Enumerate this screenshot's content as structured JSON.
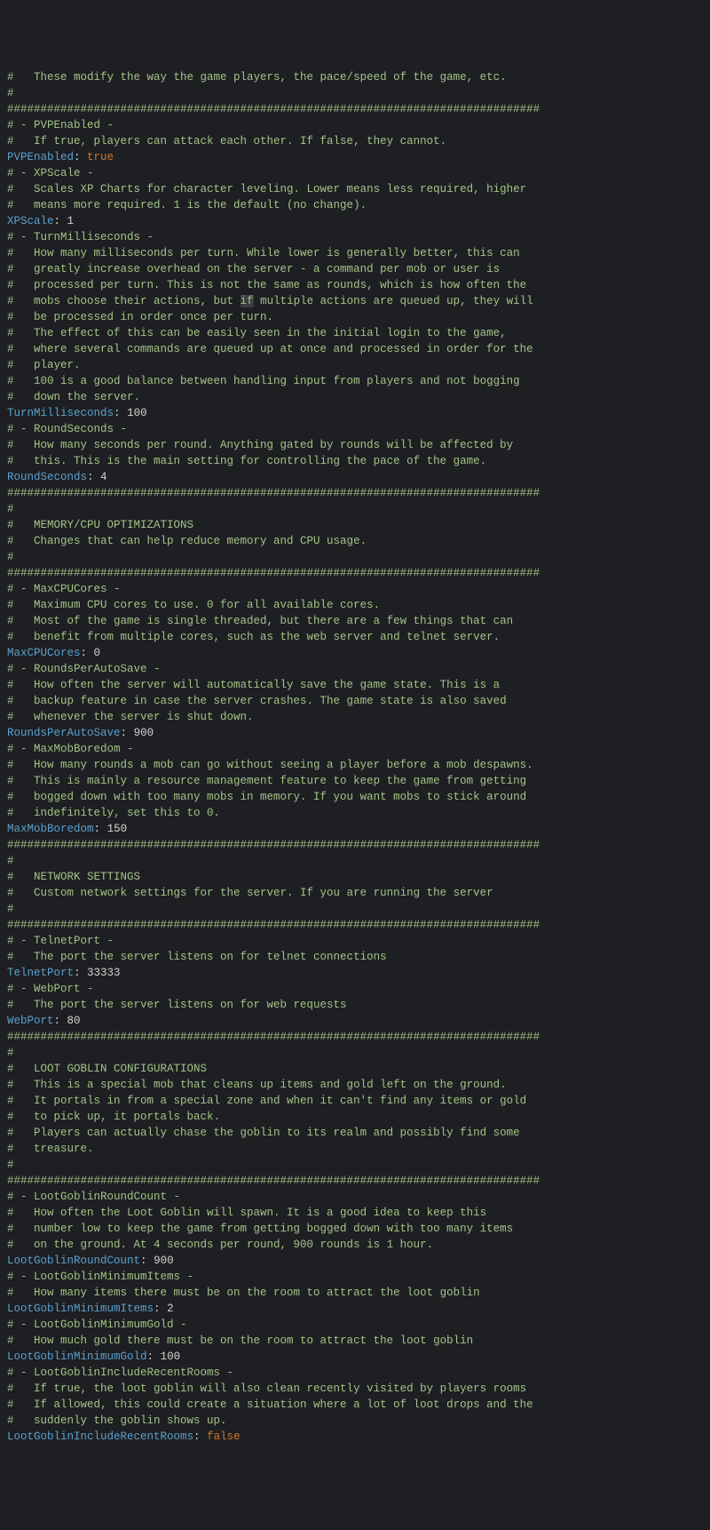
{
  "lines": [
    {
      "t": "c",
      "v": "#   These modify the way the game players, the pace/speed of the game, etc."
    },
    {
      "t": "c",
      "v": "#"
    },
    {
      "t": "c",
      "v": "################################################################################"
    },
    {
      "t": "c",
      "v": "# - PVPEnabled -"
    },
    {
      "t": "c",
      "v": "#   If true, players can attack each other. If false, they cannot."
    },
    {
      "t": "kv",
      "k": "PVPEnabled",
      "v": "true",
      "vt": "b"
    },
    {
      "t": "c",
      "v": "# - XPScale -"
    },
    {
      "t": "c",
      "v": "#   Scales XP Charts for character leveling. Lower means less required, higher"
    },
    {
      "t": "c",
      "v": "#   means more required. 1 is the default (no change)."
    },
    {
      "t": "kv",
      "k": "XPScale",
      "v": "1",
      "vt": "n"
    },
    {
      "t": "c",
      "v": "# - TurnMilliseconds -"
    },
    {
      "t": "c",
      "v": "#   How many milliseconds per turn. While lower is generally better, this can"
    },
    {
      "t": "c",
      "v": "#   greatly increase overhead on the server - a command per mob or user is"
    },
    {
      "t": "c",
      "v": "#   processed per turn. This is not the same as rounds, which is how often the"
    },
    {
      "t": "c-hl",
      "pre": "#   mobs choose their actions, but ",
      "hl": "if",
      "post": " multiple actions are queued up, they will"
    },
    {
      "t": "c",
      "v": "#   be processed in order once per turn."
    },
    {
      "t": "c",
      "v": "#   The effect of this can be easily seen in the initial login to the game,"
    },
    {
      "t": "c",
      "v": "#   where several commands are queued up at once and processed in order for the"
    },
    {
      "t": "c",
      "v": "#   player."
    },
    {
      "t": "c",
      "v": "#   100 is a good balance between handling input from players and not bogging"
    },
    {
      "t": "c",
      "v": "#   down the server."
    },
    {
      "t": "kv",
      "k": "TurnMilliseconds",
      "v": "100",
      "vt": "n"
    },
    {
      "t": "c",
      "v": "# - RoundSeconds -"
    },
    {
      "t": "c",
      "v": "#   How many seconds per round. Anything gated by rounds will be affected by"
    },
    {
      "t": "c",
      "v": "#   this. This is the main setting for controlling the pace of the game."
    },
    {
      "t": "kv",
      "k": "RoundSeconds",
      "v": "4",
      "vt": "n"
    },
    {
      "t": "c",
      "v": "################################################################################"
    },
    {
      "t": "c",
      "v": "#"
    },
    {
      "t": "c",
      "v": "#   MEMORY/CPU OPTIMIZATIONS"
    },
    {
      "t": "c",
      "v": "#   Changes that can help reduce memory and CPU usage."
    },
    {
      "t": "c",
      "v": "#"
    },
    {
      "t": "c",
      "v": "################################################################################"
    },
    {
      "t": "c",
      "v": "# - MaxCPUCores -"
    },
    {
      "t": "c",
      "v": "#   Maximum CPU cores to use. 0 for all available cores."
    },
    {
      "t": "c",
      "v": "#   Most of the game is single threaded, but there are a few things that can"
    },
    {
      "t": "c",
      "v": "#   benefit from multiple cores, such as the web server and telnet server."
    },
    {
      "t": "kv",
      "k": "MaxCPUCores",
      "v": "0",
      "vt": "n"
    },
    {
      "t": "c",
      "v": "# - RoundsPerAutoSave -"
    },
    {
      "t": "c",
      "v": "#   How often the server will automatically save the game state. This is a"
    },
    {
      "t": "c",
      "v": "#   backup feature in case the server crashes. The game state is also saved"
    },
    {
      "t": "c",
      "v": "#   whenever the server is shut down."
    },
    {
      "t": "kv",
      "k": "RoundsPerAutoSave",
      "v": "900",
      "vt": "n"
    },
    {
      "t": "c",
      "v": "# - MaxMobBoredom -"
    },
    {
      "t": "c",
      "v": "#   How many rounds a mob can go without seeing a player before a mob despawns."
    },
    {
      "t": "c",
      "v": "#   This is mainly a resource management feature to keep the game from getting"
    },
    {
      "t": "c",
      "v": "#   bogged down with too many mobs in memory. If you want mobs to stick around"
    },
    {
      "t": "c",
      "v": "#   indefinitely, set this to 0."
    },
    {
      "t": "kv",
      "k": "MaxMobBoredom",
      "v": "150",
      "vt": "n"
    },
    {
      "t": "c",
      "v": "################################################################################"
    },
    {
      "t": "c",
      "v": "#"
    },
    {
      "t": "c",
      "v": "#   NETWORK SETTINGS"
    },
    {
      "t": "c",
      "v": "#   Custom network settings for the server. If you are running the server"
    },
    {
      "t": "c",
      "v": "#"
    },
    {
      "t": "c",
      "v": "################################################################################"
    },
    {
      "t": "c",
      "v": "# - TelnetPort -"
    },
    {
      "t": "c",
      "v": "#   The port the server listens on for telnet connections"
    },
    {
      "t": "kv",
      "k": "TelnetPort",
      "v": "33333",
      "vt": "n"
    },
    {
      "t": "c",
      "v": "# - WebPort -"
    },
    {
      "t": "c",
      "v": "#   The port the server listens on for web requests"
    },
    {
      "t": "kv",
      "k": "WebPort",
      "v": "80",
      "vt": "n"
    },
    {
      "t": "c",
      "v": "################################################################################"
    },
    {
      "t": "c",
      "v": "#"
    },
    {
      "t": "c",
      "v": "#   LOOT GOBLIN CONFIGURATIONS"
    },
    {
      "t": "c",
      "v": "#   This is a special mob that cleans up items and gold left on the ground."
    },
    {
      "t": "c",
      "v": "#   It portals in from a special zone and when it can't find any items or gold"
    },
    {
      "t": "c",
      "v": "#   to pick up, it portals back."
    },
    {
      "t": "c",
      "v": "#   Players can actually chase the goblin to its realm and possibly find some"
    },
    {
      "t": "c",
      "v": "#   treasure."
    },
    {
      "t": "c",
      "v": "#"
    },
    {
      "t": "c",
      "v": "################################################################################"
    },
    {
      "t": "c",
      "v": "# - LootGoblinRoundCount -"
    },
    {
      "t": "c",
      "v": "#   How often the Loot Goblin will spawn. It is a good idea to keep this"
    },
    {
      "t": "c",
      "v": "#   number low to keep the game from getting bogged down with too many items"
    },
    {
      "t": "c",
      "v": "#   on the ground. At 4 seconds per round, 900 rounds is 1 hour."
    },
    {
      "t": "kv",
      "k": "LootGoblinRoundCount",
      "v": "900",
      "vt": "n"
    },
    {
      "t": "c",
      "v": "# - LootGoblinMinimumItems -"
    },
    {
      "t": "c",
      "v": "#   How many items there must be on the room to attract the loot goblin"
    },
    {
      "t": "kv",
      "k": "LootGoblinMinimumItems",
      "v": "2",
      "vt": "n"
    },
    {
      "t": "c",
      "v": "# - LootGoblinMinimumGold -"
    },
    {
      "t": "c",
      "v": "#   How much gold there must be on the room to attract the loot goblin"
    },
    {
      "t": "kv",
      "k": "LootGoblinMinimumGold",
      "v": "100",
      "vt": "n"
    },
    {
      "t": "c",
      "v": "# - LootGoblinIncludeRecentRooms -"
    },
    {
      "t": "c",
      "v": "#   If true, the loot goblin will also clean recently visited by players rooms"
    },
    {
      "t": "c",
      "v": "#   If allowed, this could create a situation where a lot of loot drops and the"
    },
    {
      "t": "c",
      "v": "#   suddenly the goblin shows up."
    },
    {
      "t": "kv",
      "k": "LootGoblinIncludeRecentRooms",
      "v": "false",
      "vt": "b"
    }
  ]
}
